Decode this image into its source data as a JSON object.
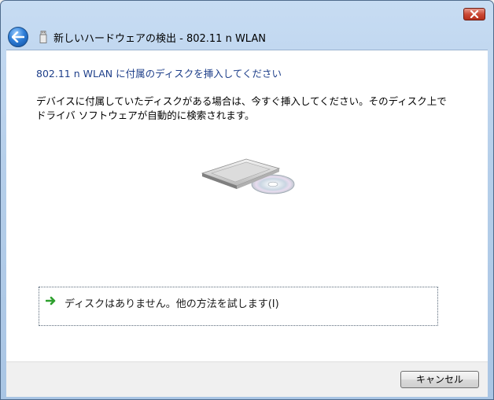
{
  "window": {
    "title": "新しいハードウェアの検出 - 802.11 n WLAN",
    "icons": {
      "back": "back-arrow-icon",
      "close": "close-icon",
      "device": "usb-device-icon"
    }
  },
  "content": {
    "heading": "802.11 n WLAN に付属のディスクを挿入してください",
    "description_lines": [
      "デバイスに付属していたディスクがある場合は、今すぐ挿入してください。そのディスク上で",
      "ドライバ ソフトウェアが自動的に検索されます。"
    ],
    "image": "disc-drive-illustration",
    "option": {
      "label": "ディスクはありません。他の方法を試します(I)",
      "icon": "green-arrow-icon"
    }
  },
  "footer": {
    "cancel_label": "キャンセル"
  },
  "colors": {
    "heading": "#1e3f8a",
    "accent_arrow": "#2ea02e",
    "close": "#c43c28"
  }
}
